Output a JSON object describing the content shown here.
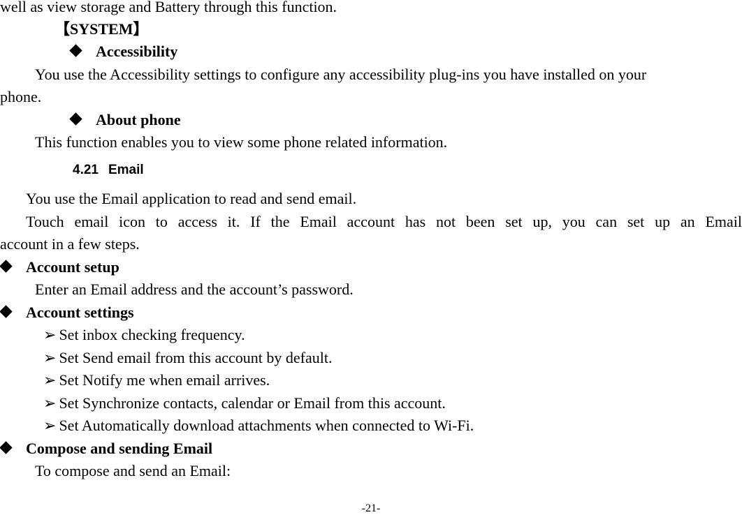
{
  "page": {
    "continuation": "well as view storage and Battery through this function.",
    "system_section": {
      "title": "【SYSTEM】",
      "items": [
        {
          "title": "Accessibility",
          "description_line1": "You use the Accessibility settings to configure any accessibility plug-ins you have installed on your",
          "description_line2": "phone."
        },
        {
          "title": "About phone",
          "description": "This function enables you to view some phone related information."
        }
      ]
    },
    "email_section": {
      "number": "4.21",
      "title": "Email",
      "intro": "You use the Email application to read and send email.",
      "touch_line1": "Touch email icon to access it. If the Email account has not been set up, you can set up an Email",
      "touch_line2": "account in a few steps.",
      "subsections": [
        {
          "title": "Account setup",
          "description": "Enter an Email address and the account’s password."
        },
        {
          "title": "Account settings",
          "bullets": [
            "Set inbox checking frequency.",
            "Set Send email from this account by default.",
            "Set Notify me when email arrives.",
            "Set Synchronize contacts, calendar or Email from this account.",
            "Set Automatically download attachments when connected to Wi-Fi."
          ]
        },
        {
          "title": "Compose and sending Email",
          "description": "To compose and send an Email:"
        }
      ]
    },
    "page_number": "-21-",
    "icons": {
      "diamond_bullet": "diamond-icon",
      "arrow_bullet": "➢"
    }
  }
}
